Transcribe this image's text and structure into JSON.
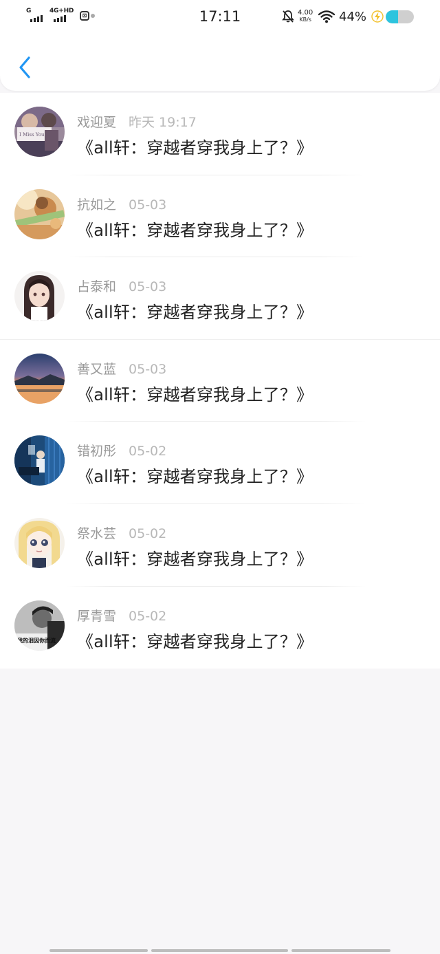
{
  "status_bar": {
    "network_1": "G",
    "network_2": "4G+HD",
    "time": "17:11",
    "speed_value": "4.00",
    "speed_unit": "KB/s",
    "battery_percent": "44%",
    "battery_level": 0.44,
    "icons": [
      "signal-icon",
      "app-notification-icon",
      "mute-bell-icon",
      "wifi-icon",
      "charging-bolt-icon",
      "battery-icon"
    ]
  },
  "header": {
    "back_icon": "chevron-left-icon",
    "accent_color": "#2196f3"
  },
  "messages": [
    {
      "name": "戏迎夏",
      "time": "昨天 19:17",
      "text": "《all轩：穿越者穿我身上了？》"
    },
    {
      "name": "抗如之",
      "time": "05-03",
      "text": "《all轩：穿越者穿我身上了？》"
    },
    {
      "name": "占泰和",
      "time": "05-03",
      "text": "《all轩：穿越者穿我身上了？》"
    },
    {
      "name": "善又蓝",
      "time": "05-03",
      "text": "《all轩：穿越者穿我身上了？》"
    },
    {
      "name": "错初彤",
      "time": "05-02",
      "text": "《all轩：穿越者穿我身上了？》"
    },
    {
      "name": "祭水芸",
      "time": "05-02",
      "text": "《all轩：穿越者穿我身上了？》"
    },
    {
      "name": "厚青雪",
      "time": "05-02",
      "text": "《all轩：穿越者穿我身上了？》"
    }
  ],
  "avatar_lettering": {
    "avatar_1": "I Miss You",
    "avatar_7": "我的泪因你而流"
  }
}
